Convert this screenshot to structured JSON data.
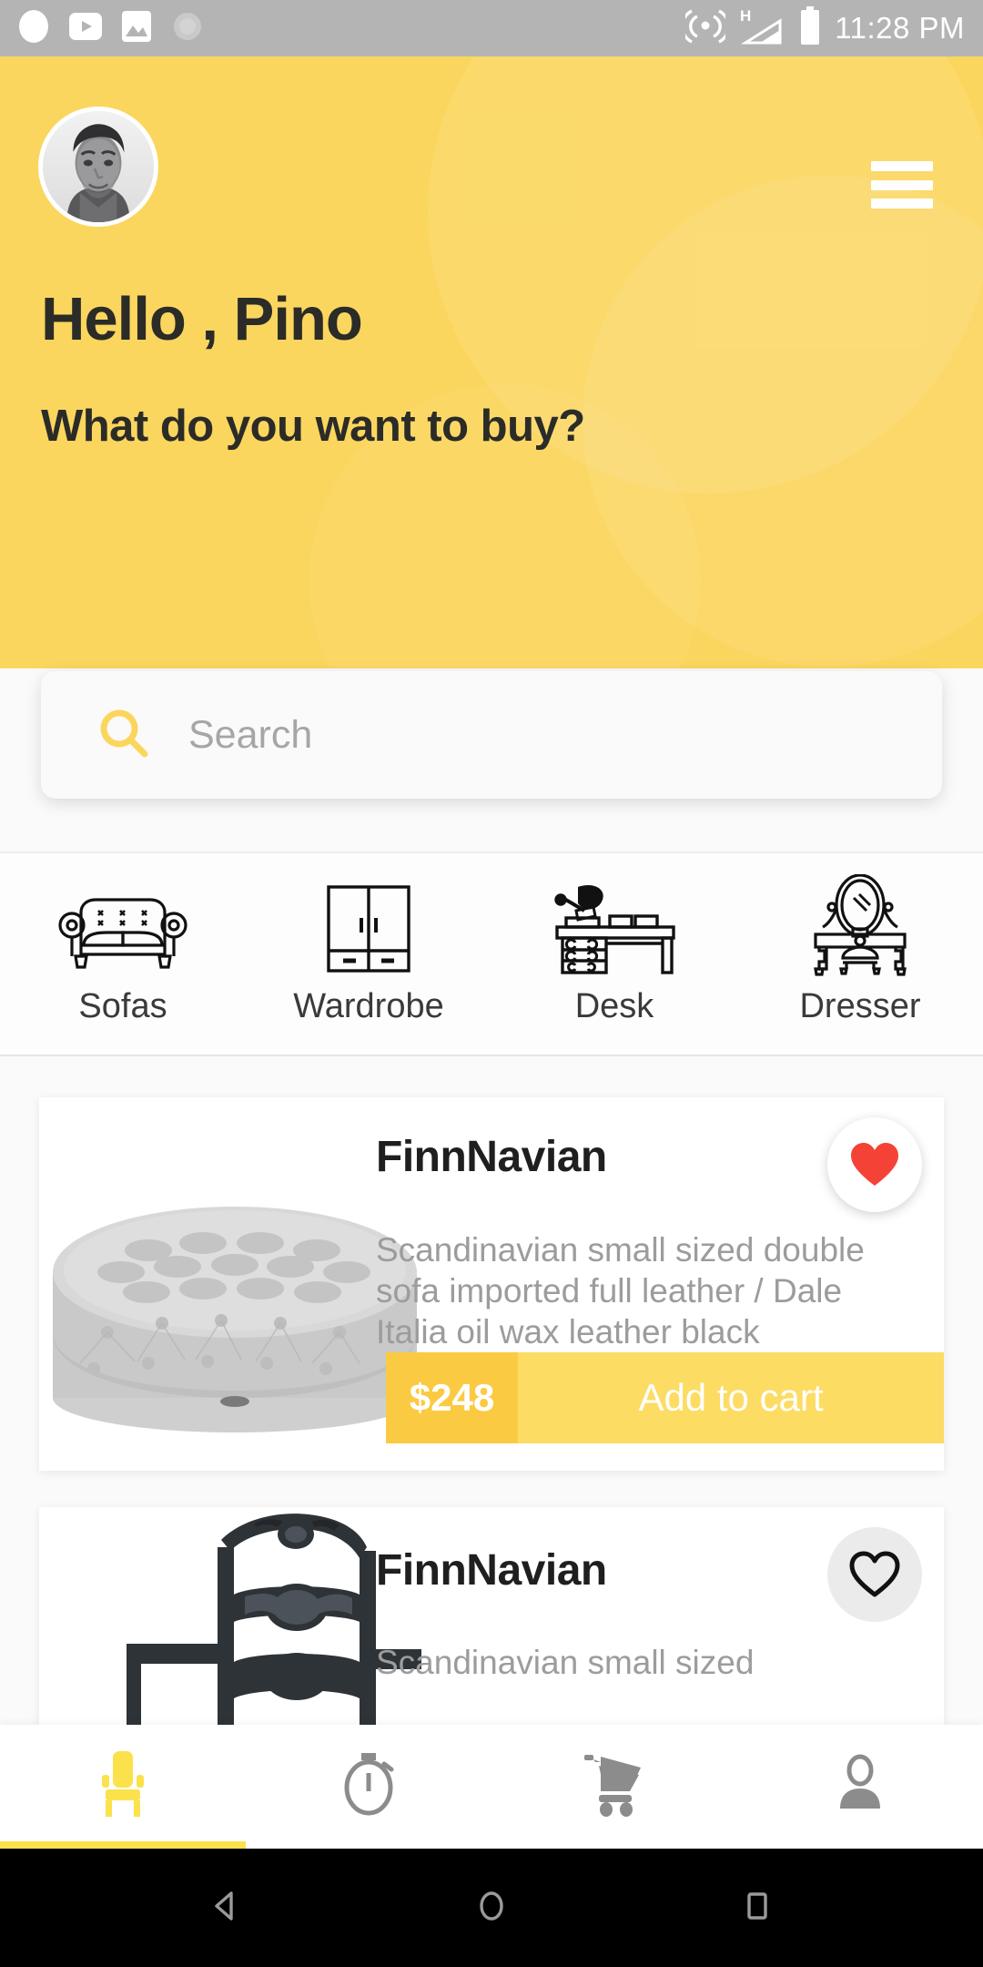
{
  "statusbar": {
    "time": "11:28 PM",
    "left_icons": [
      "circle-icon",
      "youtube-icon",
      "image-icon",
      "sun-loading-icon"
    ],
    "right_icons": [
      "cast-icon",
      "hspa-signal-icon",
      "battery-icon"
    ],
    "network_label": "H",
    "background": "#b4b4b4"
  },
  "header": {
    "greeting": "Hello , Pino",
    "subgreeting": "What do you want to buy?",
    "avatar_name": "user-avatar",
    "menu_name": "hamburger-menu-button",
    "background": "#fbd65e"
  },
  "search": {
    "placeholder": "Search",
    "value": "",
    "icon": "search-icon",
    "icon_color": "#fbd65e"
  },
  "categories": [
    {
      "label": "Sofas",
      "icon": "sofa-icon"
    },
    {
      "label": "Wardrobe",
      "icon": "wardrobe-icon"
    },
    {
      "label": "Desk",
      "icon": "desk-icon"
    },
    {
      "label": "Dresser",
      "icon": "dresser-icon"
    }
  ],
  "products": [
    {
      "title": "FinnNavian",
      "description": "Scandinavian small sized double sofa imported full leather / Dale Italia oil wax leather black",
      "price": "$248",
      "add_to_cart_label": "Add to cart",
      "favorited": true,
      "heart_color": "#f44336",
      "image": "gray-tufted-round-ottoman",
      "price_bg": "#fbca43",
      "cart_bg": "#fcdc63"
    },
    {
      "title": "FinnNavian",
      "description": "Scandinavian small sized",
      "favorited": false,
      "heart_color": "#111111",
      "image": "dark-ornate-wooden-chair"
    }
  ],
  "bottom_nav": {
    "items": [
      {
        "icon": "chair-icon",
        "active": true,
        "color": "#fbe24c"
      },
      {
        "icon": "stopwatch-icon",
        "active": false,
        "color": "#8c8c8c"
      },
      {
        "icon": "cart-icon",
        "active": false,
        "color": "#8c8c8c"
      },
      {
        "icon": "person-icon",
        "active": false,
        "color": "#8c8c8c"
      }
    ],
    "indicator_color": "#fbe24c"
  },
  "android_nav": {
    "back": "back-triangle-icon",
    "home": "home-circle-icon",
    "recents": "recents-square-icon",
    "background": "#000000"
  }
}
